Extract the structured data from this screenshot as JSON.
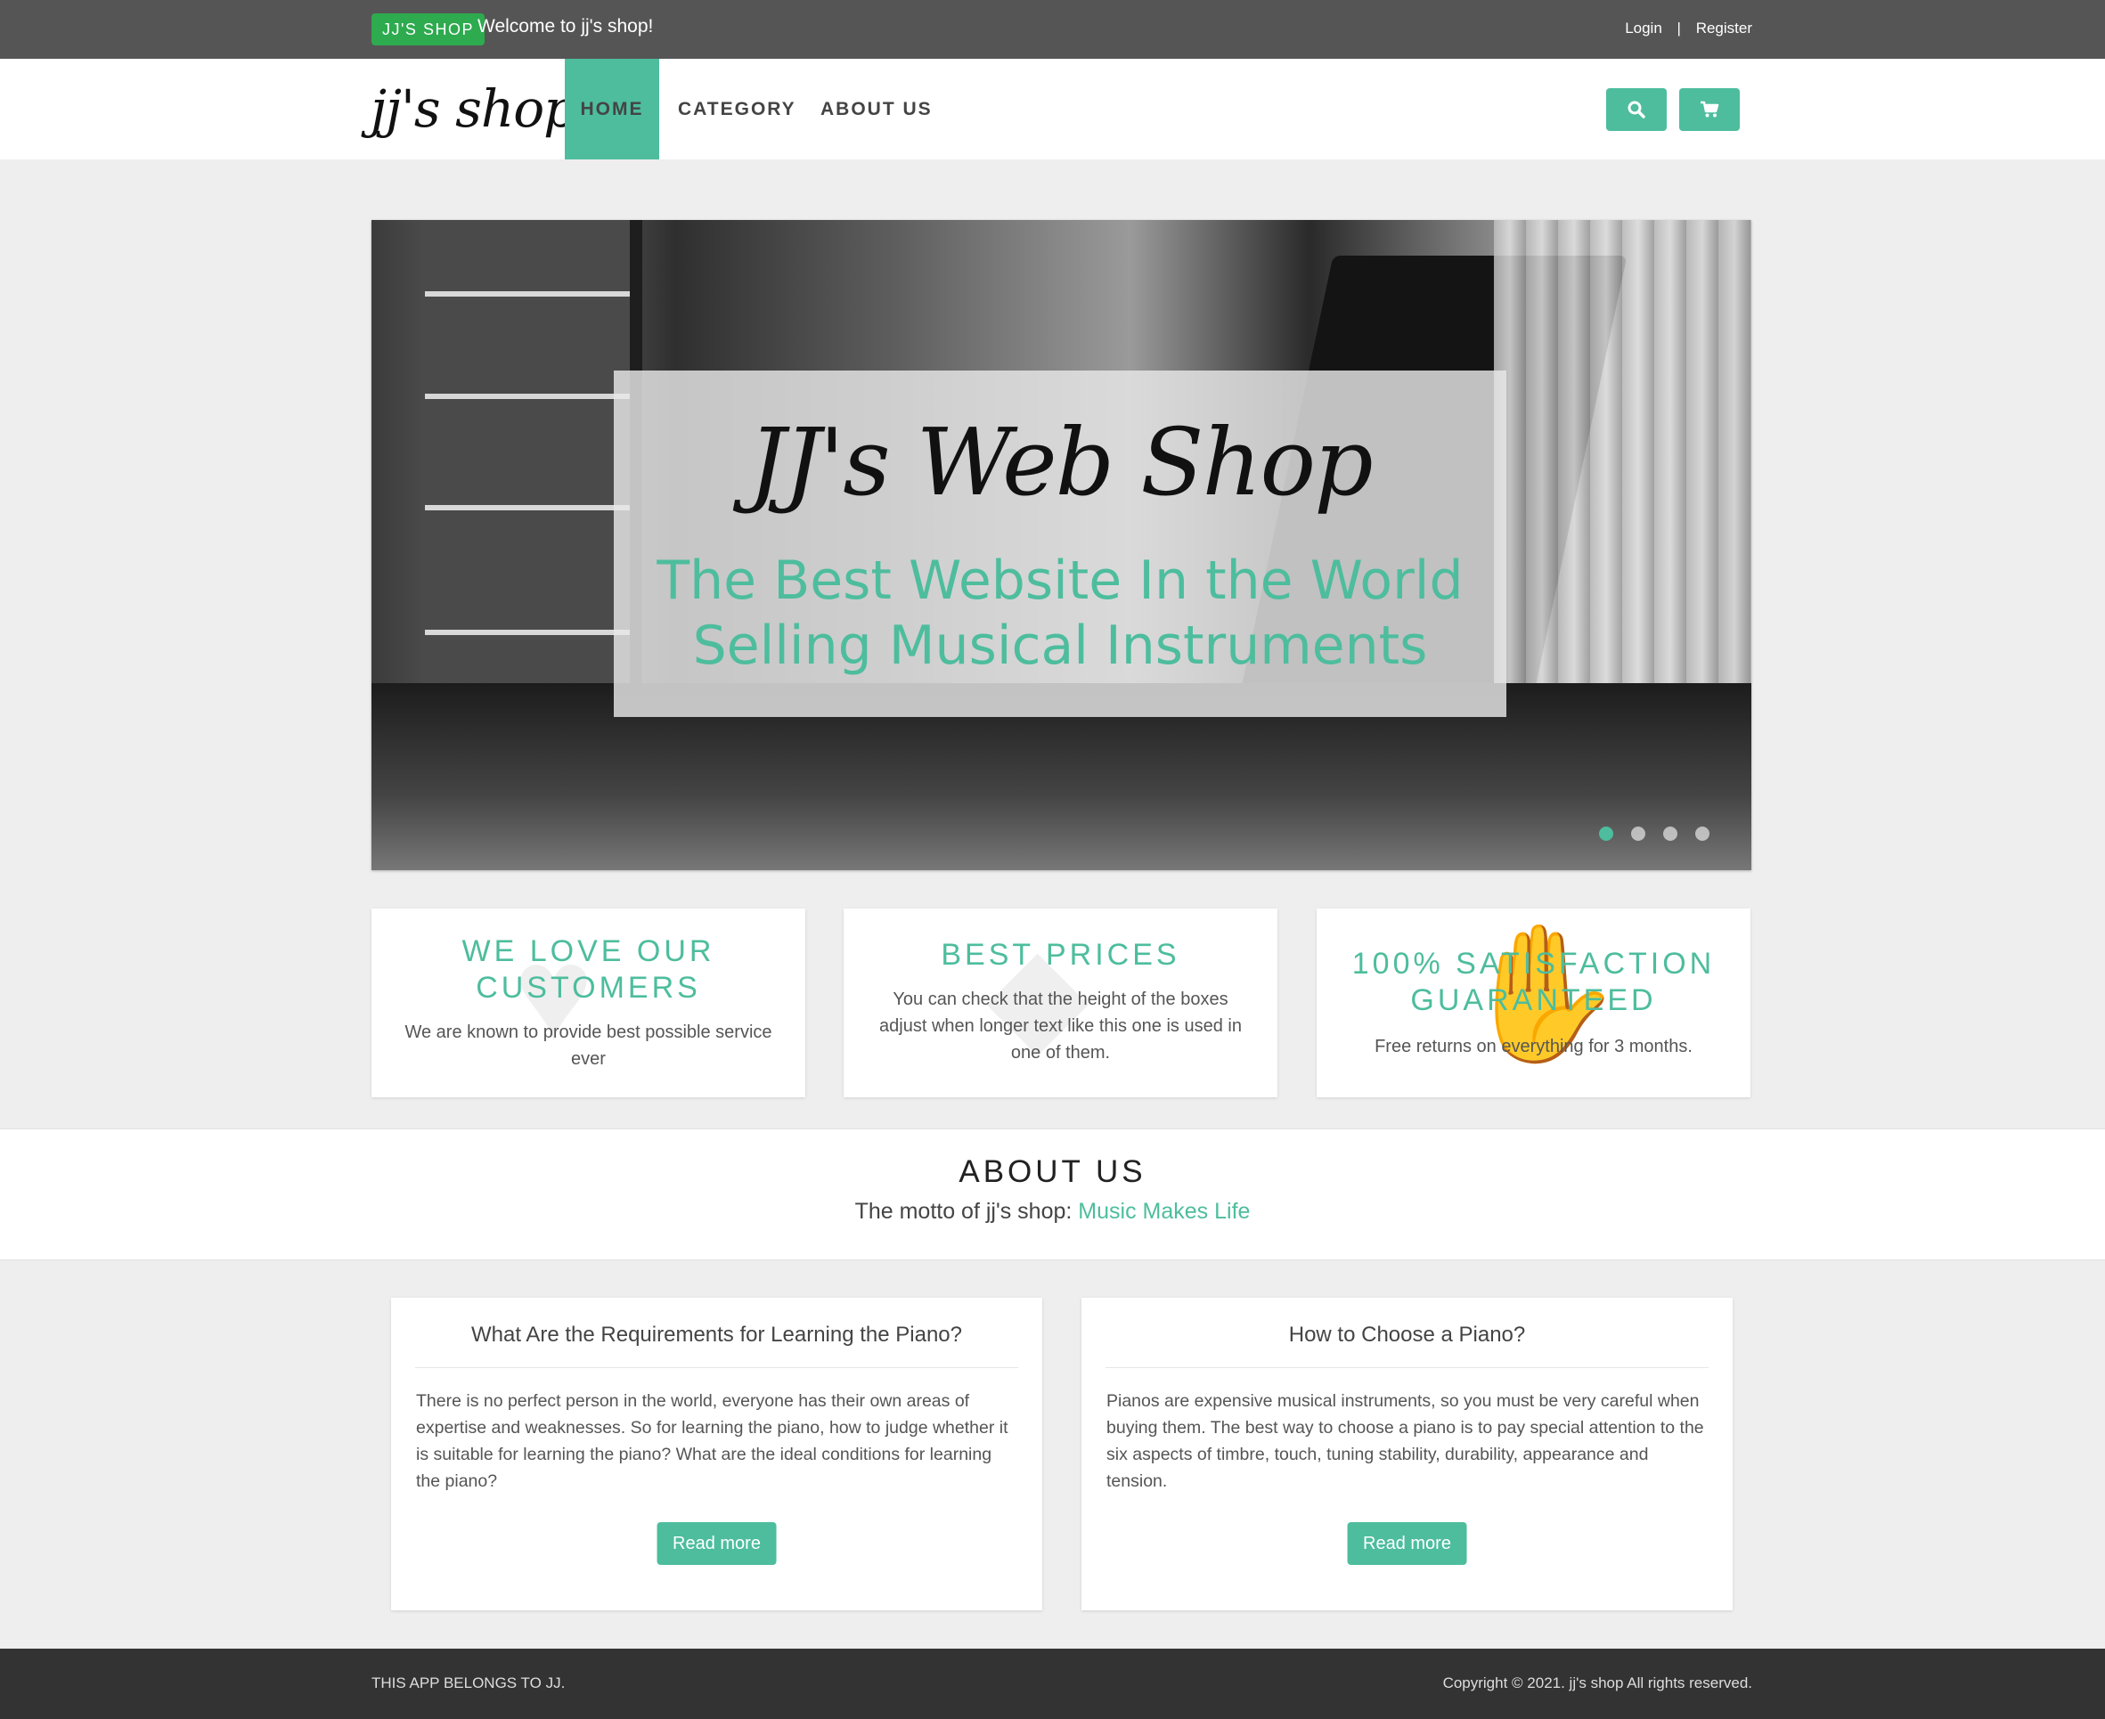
{
  "topbar": {
    "badge": "JJ'S SHOP",
    "welcome": "Welcome to jj's shop!",
    "login": "Login",
    "separator": "|",
    "register": "Register"
  },
  "navbar": {
    "brand": "jj's shop",
    "items": [
      {
        "label": "HOME",
        "active": true
      },
      {
        "label": "CATEGORY",
        "active": false
      },
      {
        "label": "ABOUT US",
        "active": false
      }
    ],
    "search_icon": "search-icon",
    "cart_icon": "shopping-cart-icon"
  },
  "hero": {
    "title": "JJ's Web Shop",
    "subtitle_line1": "The Best Website In the World",
    "subtitle_line2": "Selling Musical Instruments",
    "slides": 4,
    "active_slide": 1
  },
  "features": [
    {
      "title": "WE LOVE OUR CUSTOMERS",
      "text": "We are known to provide best possible service ever",
      "icon": "heart-icon"
    },
    {
      "title": "BEST PRICES",
      "text": "You can check that the height of the boxes adjust when longer text like this one is used in one of them.",
      "icon": "tag-icon"
    },
    {
      "title": "100% SATISFACTION GUARANTEED",
      "text": "Free returns on everything for 3 months.",
      "icon": "thumbs-up-icon"
    }
  ],
  "about": {
    "title": "ABOUT US",
    "motto_prefix": "The motto of jj's shop:",
    "motto": "Music Makes Life"
  },
  "articles": [
    {
      "title": "What Are the Requirements for Learning the Piano?",
      "body": "There is no perfect person in the world, everyone has their own areas of expertise and weaknesses. So for learning the piano, how to judge whether it is suitable for learning the piano? What are the ideal conditions for learning the piano?",
      "button": "Read more"
    },
    {
      "title": "How to Choose a Piano?",
      "body": "Pianos are expensive musical instruments, so you must be very careful when buying them. The best way to choose a piano is to pay special attention to the six aspects of timbre, touch, tuning stability, durability, appearance and tension.",
      "button": "Read more"
    }
  ],
  "footer": {
    "left": "THIS APP BELONGS TO JJ.",
    "right": "Copyright © 2021. jj's shop All rights reserved."
  },
  "colors": {
    "accent": "#4dbd9d",
    "badge": "#2eaa4f",
    "topbar": "#555555",
    "footer": "#333333"
  }
}
